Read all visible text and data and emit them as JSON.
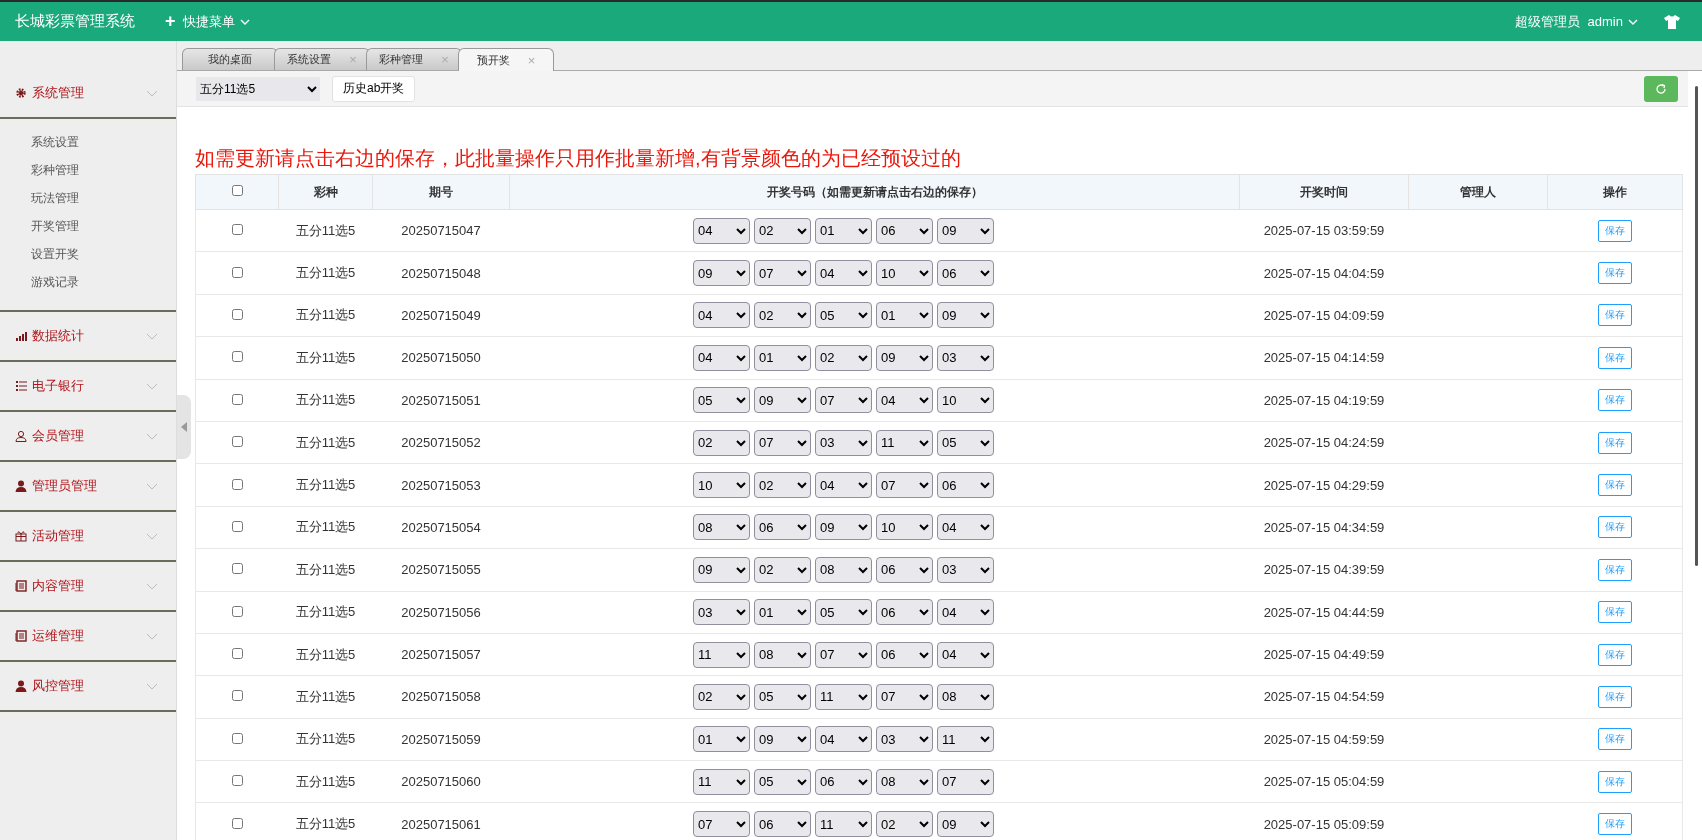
{
  "header": {
    "title": "长城彩票管理系统",
    "quick_menu": {
      "icon": "+",
      "label": "快捷菜单"
    },
    "user_role": "超级管理员",
    "user_name": "admin"
  },
  "tabs": [
    {
      "label": "我的桌面",
      "selected": false
    },
    {
      "label": "系统设置",
      "selected": false,
      "close": "×"
    },
    {
      "label": "彩种管理",
      "selected": false,
      "close": "×"
    },
    {
      "label": "预开奖",
      "selected": true,
      "close": "×"
    }
  ],
  "sidebar": {
    "groups": [
      {
        "label": "系统管理",
        "children": [
          "系统设置",
          "彩种管理",
          "玩法管理",
          "开奖管理",
          "设置开奖",
          "游戏记录"
        ]
      },
      {
        "label": "数据统计"
      },
      {
        "label": "电子银行"
      },
      {
        "label": "会员管理"
      },
      {
        "label": "管理员管理"
      },
      {
        "label": "活动管理"
      },
      {
        "label": "内容管理"
      },
      {
        "label": "运维管理"
      },
      {
        "label": "风控管理"
      }
    ]
  },
  "toolbar": {
    "lottery_select": "五分11选5",
    "history_button": "历史ab开奖"
  },
  "notice": "如需更新请点击右边的保存，此批量操作只用作批量新增,有背景颜色的为已经预设过的",
  "table": {
    "select_all_checked": false,
    "columns": [
      "彩种",
      "期号",
      "开奖号码（如需更新请点击右边的保存）",
      "开奖时间",
      "管理人",
      "操作"
    ],
    "rows": [
      {
        "checked": false,
        "lottery": "五分11选5",
        "issue": "20250715047",
        "numbers": [
          "04",
          "02",
          "01",
          "06",
          "09"
        ],
        "time": "2025-07-15 03:59:59",
        "action": "保存"
      },
      {
        "checked": false,
        "lottery": "五分11选5",
        "issue": "20250715048",
        "numbers": [
          "09",
          "07",
          "04",
          "10",
          "06"
        ],
        "time": "2025-07-15 04:04:59",
        "action": "保存"
      },
      {
        "checked": false,
        "lottery": "五分11选5",
        "issue": "20250715049",
        "numbers": [
          "04",
          "02",
          "05",
          "01",
          "09"
        ],
        "time": "2025-07-15 04:09:59",
        "action": "保存"
      },
      {
        "checked": false,
        "lottery": "五分11选5",
        "issue": "20250715050",
        "numbers": [
          "04",
          "01",
          "02",
          "09",
          "03"
        ],
        "time": "2025-07-15 04:14:59",
        "action": "保存"
      },
      {
        "checked": false,
        "lottery": "五分11选5",
        "issue": "20250715051",
        "numbers": [
          "05",
          "09",
          "07",
          "04",
          "10"
        ],
        "time": "2025-07-15 04:19:59",
        "action": "保存"
      },
      {
        "checked": false,
        "lottery": "五分11选5",
        "issue": "20250715052",
        "numbers": [
          "02",
          "07",
          "03",
          "11",
          "05"
        ],
        "time": "2025-07-15 04:24:59",
        "action": "保存"
      },
      {
        "checked": false,
        "lottery": "五分11选5",
        "issue": "20250715053",
        "numbers": [
          "10",
          "02",
          "04",
          "07",
          "06"
        ],
        "time": "2025-07-15 04:29:59",
        "action": "保存"
      },
      {
        "checked": false,
        "lottery": "五分11选5",
        "issue": "20250715054",
        "numbers": [
          "08",
          "06",
          "09",
          "10",
          "04"
        ],
        "time": "2025-07-15 04:34:59",
        "action": "保存"
      },
      {
        "checked": false,
        "lottery": "五分11选5",
        "issue": "20250715055",
        "numbers": [
          "09",
          "02",
          "08",
          "06",
          "03"
        ],
        "time": "2025-07-15 04:39:59",
        "action": "保存"
      },
      {
        "checked": false,
        "lottery": "五分11选5",
        "issue": "20250715056",
        "numbers": [
          "03",
          "01",
          "05",
          "06",
          "04"
        ],
        "time": "2025-07-15 04:44:59",
        "action": "保存"
      },
      {
        "checked": false,
        "lottery": "五分11选5",
        "issue": "20250715057",
        "numbers": [
          "11",
          "08",
          "07",
          "06",
          "04"
        ],
        "time": "2025-07-15 04:49:59",
        "action": "保存"
      },
      {
        "checked": false,
        "lottery": "五分11选5",
        "issue": "20250715058",
        "numbers": [
          "02",
          "05",
          "11",
          "07",
          "08"
        ],
        "time": "2025-07-15 04:54:59",
        "action": "保存"
      },
      {
        "checked": false,
        "lottery": "五分11选5",
        "issue": "20250715059",
        "numbers": [
          "01",
          "09",
          "04",
          "03",
          "11"
        ],
        "time": "2025-07-15 04:59:59",
        "action": "保存"
      },
      {
        "checked": false,
        "lottery": "五分11选5",
        "issue": "20250715060",
        "numbers": [
          "11",
          "05",
          "06",
          "08",
          "07"
        ],
        "time": "2025-07-15 05:04:59",
        "action": "保存"
      },
      {
        "checked": false,
        "lottery": "五分11选5",
        "issue": "20250715061",
        "numbers": [
          "07",
          "06",
          "11",
          "02",
          "09"
        ],
        "time": "2025-07-15 05:09:59",
        "action": "保存"
      }
    ]
  }
}
